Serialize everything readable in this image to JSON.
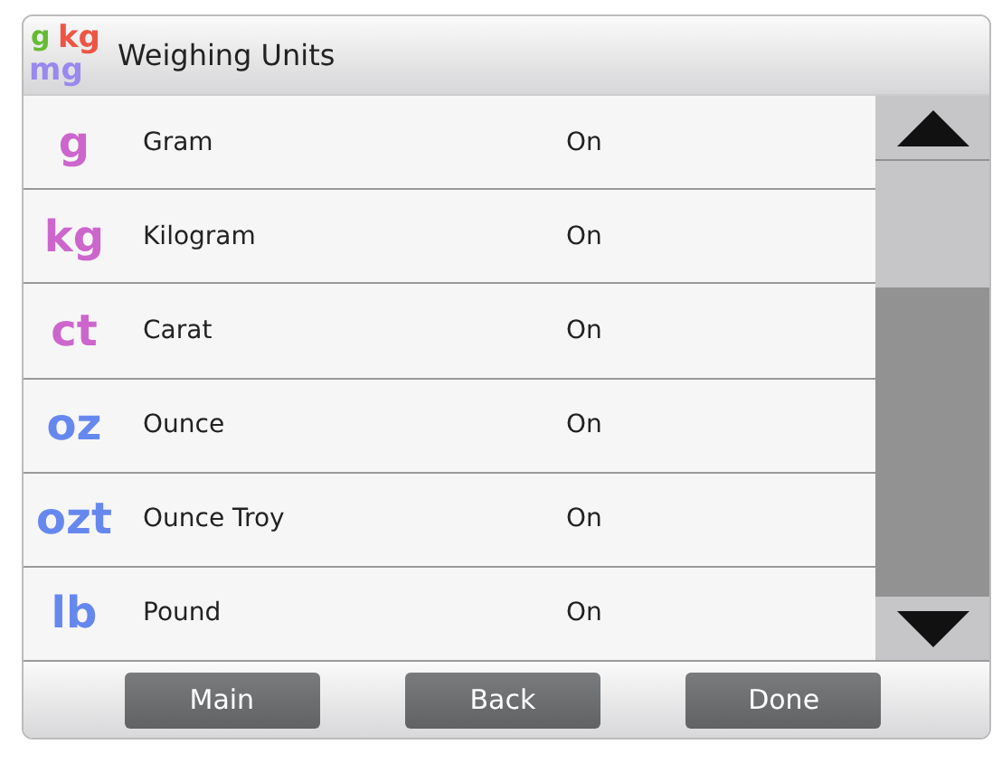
{
  "window": {
    "title": "Weighing Units",
    "logo": [
      {
        "symbol": "g",
        "color": "#66bb33"
      },
      {
        "symbol": "kg",
        "color": "#ee5544"
      },
      {
        "symbol": "mg",
        "color": "#9988ee"
      }
    ]
  },
  "units": [
    {
      "symbol": "g",
      "color": "#cc66cc",
      "name": "Gram",
      "status": "On"
    },
    {
      "symbol": "kg",
      "color": "#cc66cc",
      "name": "Kilogram",
      "status": "On"
    },
    {
      "symbol": "ct",
      "color": "#cc66cc",
      "name": "Carat",
      "status": "On"
    },
    {
      "symbol": "oz",
      "color": "#6688ee",
      "name": "Ounce",
      "status": "On"
    },
    {
      "symbol": "ozt",
      "color": "#6688ee",
      "name": "Ounce Troy",
      "status": "On"
    },
    {
      "symbol": "lb",
      "color": "#6688ee",
      "name": "Pound",
      "status": "On"
    }
  ],
  "buttons": [
    "Main",
    "Back",
    "Done"
  ]
}
